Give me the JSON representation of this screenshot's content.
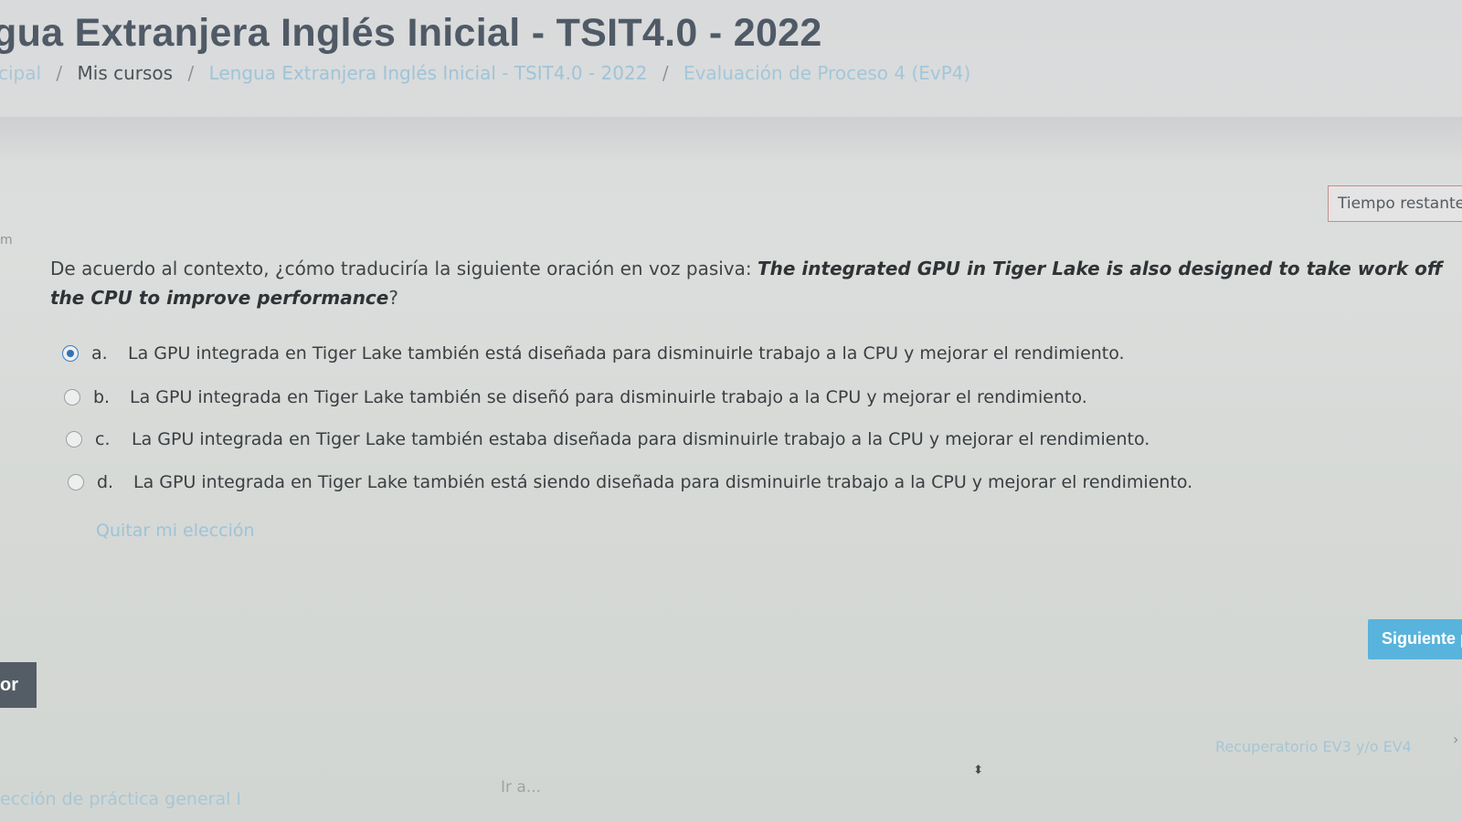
{
  "header": {
    "title": "gua Extranjera Inglés Inicial - TSIT4.0 - 2022",
    "breadcrumb": {
      "home": "cipal",
      "separator": "/",
      "courses": "Mis cursos",
      "course": "Lengua Extranjera Inglés Inicial - TSIT4.0 - 2022",
      "evaluation": "Evaluación de Proceso 4 (EvP4)"
    }
  },
  "timer": {
    "label": "Tiempo restante"
  },
  "side_marker": "m",
  "question": {
    "prompt": "De acuerdo al contexto, ¿cómo traduciría la siguiente oración en voz pasiva: ",
    "sentence": "The integrated GPU in Tiger Lake is also designed to take work off the CPU to improve performance",
    "end": "?",
    "options": [
      {
        "letter": "a.",
        "text": "La GPU integrada en Tiger Lake también está diseñada para disminuirle trabajo a la CPU y mejorar el rendimiento.",
        "selected": true
      },
      {
        "letter": "b.",
        "text": "La GPU integrada en Tiger Lake también se diseñó para disminuirle trabajo a la CPU y mejorar el rendimiento.",
        "selected": false
      },
      {
        "letter": "c.",
        "text": "La GPU integrada en Tiger Lake también estaba diseñada para disminuirle trabajo a la CPU y mejorar el rendimiento.",
        "selected": false
      },
      {
        "letter": "d.",
        "text": "La GPU integrada en Tiger Lake también está siendo diseñada para disminuirle trabajo a la CPU y mejorar el rendimiento.",
        "selected": false
      }
    ],
    "clear_choice": "Quitar mi elección"
  },
  "navigation": {
    "next_button": "Siguiente p",
    "prev_button": "or",
    "prev_activity": "ección de práctica general I",
    "jump_placeholder": "Ir a...",
    "next_activity": "Recuperatorio EV3 y/o EV4",
    "next_arrow": "›"
  },
  "colors": {
    "title": "#4f5a66",
    "link": "#9fc4d8",
    "accent_button": "#58b4dd",
    "dark_button": "#545d66",
    "timer_border": "#c78b8b",
    "radio_selected": "#2f72b8"
  }
}
